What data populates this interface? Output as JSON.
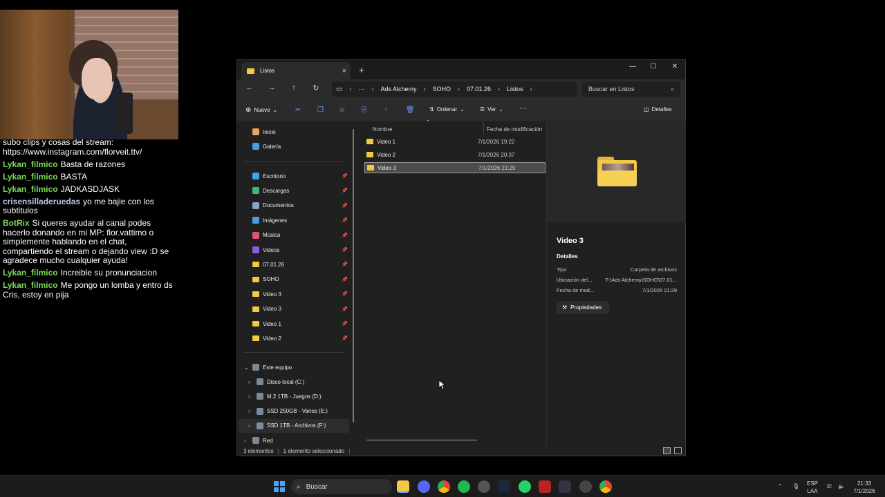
{
  "chat": [
    {
      "user": "",
      "user_color": "#ffffff",
      "text": "subo clips y cosas del stream: https://www.instagram.com/florveit.ttv/"
    },
    {
      "user": "Lykan_filmico",
      "user_color": "#7ed957",
      "text": "Basta de razones"
    },
    {
      "user": "Lykan_filmico",
      "user_color": "#7ed957",
      "text": "BASTA"
    },
    {
      "user": "Lykan_filmico",
      "user_color": "#7ed957",
      "text": "JADKASDJASK"
    },
    {
      "user": "crisensilladeruedas",
      "user_color": "#b9c6e8",
      "text": "yo me bajie con los subtitulos"
    },
    {
      "user": "BotRix",
      "user_color": "#7ed957",
      "text": "Si queres ayudar al canal podes hacerlo donando en mi MP: flor.vattimo o simplemente hablando en el chat, compartiendo el stream o dejando view :D se agradece mucho cualquier ayuda!"
    },
    {
      "user": "Lykan_filmico",
      "user_color": "#7ed957",
      "text": "Increible su pronunciacion"
    },
    {
      "user": "Lykan_filmico",
      "user_color": "#7ed957",
      "text": "Me pongo un lomba y entro ds Cris, estoy en pija"
    }
  ],
  "window": {
    "tab_title": "Listos",
    "tab_close": "×",
    "tab_add": "+",
    "controls": {
      "minimize": "—",
      "maximize": "☐",
      "close": "✕"
    },
    "breadcrumbs": [
      "Ads Alchemy",
      "SOHO",
      "07.01.26",
      "Listos"
    ],
    "search_placeholder": "Buscar en Listos"
  },
  "toolbar": {
    "new_label": "Nuevo",
    "sort_label": "Ordenar",
    "view_label": "Ver",
    "more_label": "···",
    "details_label": "Detalles"
  },
  "sidebar": {
    "top": [
      {
        "label": "Inicio",
        "icon": "home-icon"
      },
      {
        "label": "Galería",
        "icon": "gallery-icon"
      }
    ],
    "pinned": [
      {
        "label": "Escritorio",
        "icon": "desktop-icon"
      },
      {
        "label": "Descargas",
        "icon": "download-icon"
      },
      {
        "label": "Documentos",
        "icon": "documents-icon"
      },
      {
        "label": "Imágenes",
        "icon": "images-icon"
      },
      {
        "label": "Música",
        "icon": "music-icon"
      },
      {
        "label": "Videos",
        "icon": "videos-icon"
      },
      {
        "label": "07.01.26",
        "icon": "folder-icon"
      },
      {
        "label": "SOHO",
        "icon": "folder-icon"
      },
      {
        "label": "Video 3",
        "icon": "folder-icon"
      },
      {
        "label": "Video 3",
        "icon": "folder-icon"
      },
      {
        "label": "Video 1",
        "icon": "folder-icon"
      },
      {
        "label": "Video 2",
        "icon": "folder-icon"
      }
    ],
    "this_pc": "Este equipo",
    "drives": [
      {
        "label": "Disco local (C:)"
      },
      {
        "label": "M.2 1TB - Juegos (D:)"
      },
      {
        "label": "SSD 250GB - Varios (E:)"
      },
      {
        "label": "SSD 1TB - Archivos (F:)"
      }
    ],
    "network": "Red"
  },
  "files": {
    "columns": {
      "name": "Nombre",
      "date": "Fecha de modificación"
    },
    "rows": [
      {
        "name": "Video 1",
        "date": "7/1/2026 19:22"
      },
      {
        "name": "Video 2",
        "date": "7/1/2026 20:37"
      },
      {
        "name": "Video 3",
        "date": "7/1/2026 21:29"
      }
    ]
  },
  "details": {
    "title": "Video 3",
    "section": "Detalles",
    "rows": [
      {
        "label": "Tipo",
        "value": "Carpeta de archivos"
      },
      {
        "label": "Ubicación del...",
        "value": "F:\\Ads Alchemy\\SOHO\\07.01..."
      },
      {
        "label": "Fecha de mod...",
        "value": "7/1/2026 21:29"
      }
    ],
    "properties_label": "Propiedades"
  },
  "status": {
    "count": "3 elementos",
    "selected": "1 elemento seleccionado",
    "sep": "|"
  },
  "taskbar": {
    "search_label": "Buscar",
    "lang1": "ESP",
    "lang2": "LAA",
    "time": "21:33",
    "date": "7/1/2026"
  }
}
